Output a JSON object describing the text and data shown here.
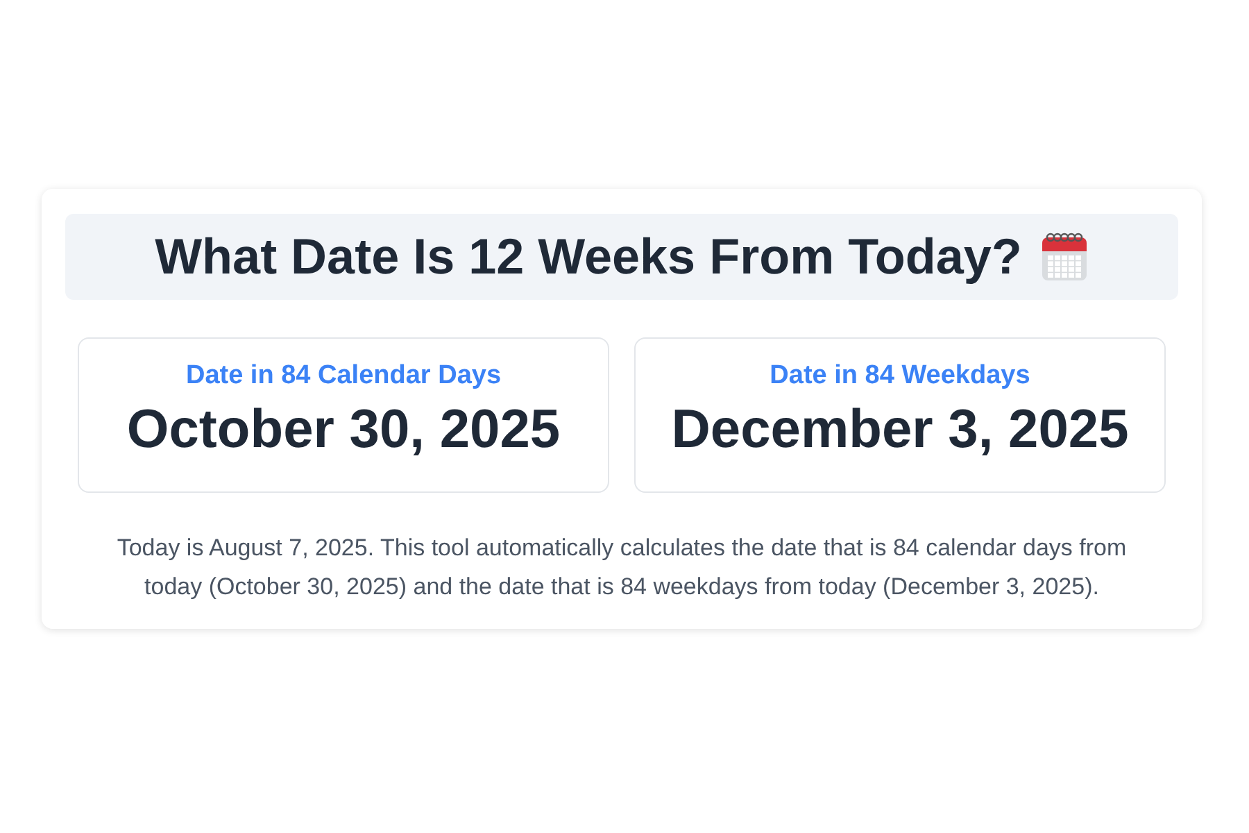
{
  "title": "What Date Is 12 Weeks From Today?",
  "results": [
    {
      "label": "Date in 84 Calendar Days",
      "date": "October 30, 2025"
    },
    {
      "label": "Date in 84 Weekdays",
      "date": "December 3, 2025"
    }
  ],
  "description": "Today is August 7, 2025. This tool automatically calculates the date that is 84 calendar days from today (October 30, 2025) and the date that is 84 weekdays from today (December 3, 2025)."
}
